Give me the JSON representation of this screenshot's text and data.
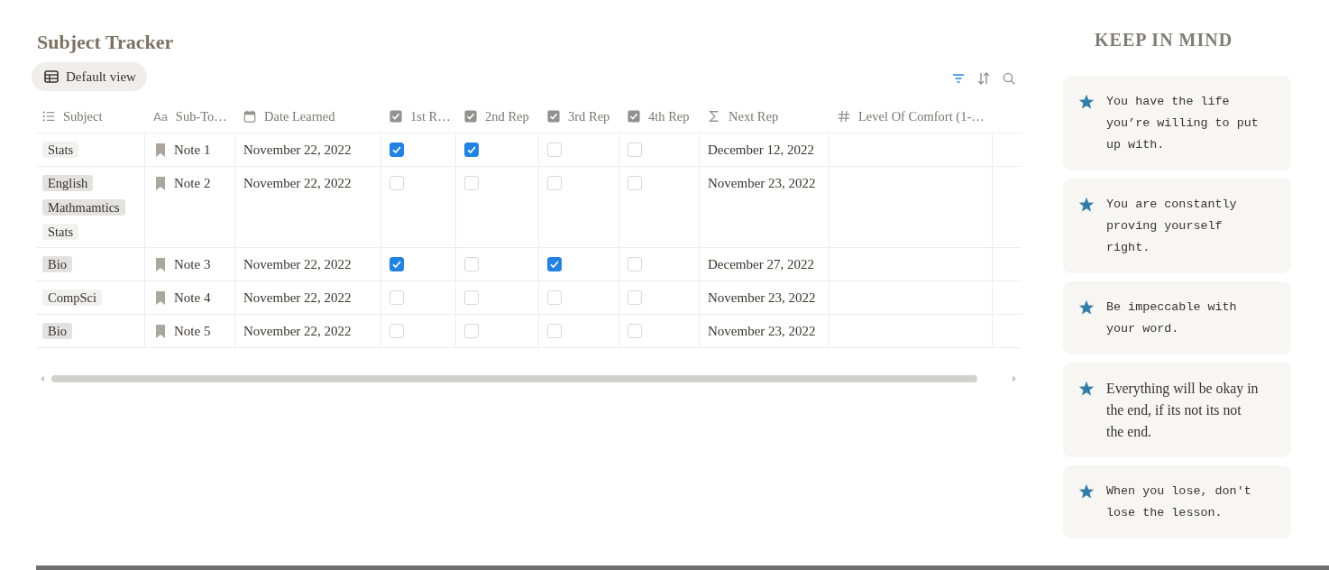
{
  "page": {
    "title": "Subject Tracker"
  },
  "toolbar": {
    "view_tab": {
      "label": "Default view",
      "selected": true
    },
    "actions": [
      {
        "kind": "filter",
        "active": true
      },
      {
        "kind": "sort",
        "active": false
      },
      {
        "kind": "search",
        "active": false
      }
    ]
  },
  "table": {
    "columns": [
      {
        "kind": "multi_select",
        "label": "Subject"
      },
      {
        "kind": "title",
        "label": "Sub-To…",
        "glyph": "Aa"
      },
      {
        "kind": "date",
        "label": "Date Learned"
      },
      {
        "kind": "checkbox",
        "label": "1st R…"
      },
      {
        "kind": "checkbox",
        "label": "2nd Rep"
      },
      {
        "kind": "checkbox",
        "label": "3rd Rep"
      },
      {
        "kind": "checkbox",
        "label": "4th Rep"
      },
      {
        "kind": "formula",
        "label": "Next Rep"
      },
      {
        "kind": "number",
        "label": "Level Of Comfort (1-…"
      }
    ],
    "rows": [
      {
        "subject": [
          {
            "label": "Stats",
            "color": "#f1f1ef"
          }
        ],
        "sub_topic": "Note 1",
        "date_learned": "November 22, 2022",
        "reps": [
          {
            "checked": true
          },
          {
            "checked": true
          },
          {
            "checked": false
          },
          {
            "checked": false
          }
        ],
        "next_rep": "December 12, 2022"
      },
      {
        "subject": [
          {
            "label": "English",
            "color": "#e3e2e0"
          },
          {
            "label": "Mathmamtics",
            "color": "#e3e2e0"
          },
          {
            "label": "Stats",
            "color": "#f1f1ef"
          }
        ],
        "sub_topic": "Note 2",
        "date_learned": "November 22, 2022",
        "reps": [
          {
            "checked": false
          },
          {
            "checked": false
          },
          {
            "checked": false
          },
          {
            "checked": false
          }
        ],
        "next_rep": "November 23, 2022"
      },
      {
        "subject": [
          {
            "label": "Bio",
            "color": "#e3e2e0"
          }
        ],
        "sub_topic": "Note 3",
        "date_learned": "November 22, 2022",
        "reps": [
          {
            "checked": true
          },
          {
            "checked": false
          },
          {
            "checked": true
          },
          {
            "checked": false
          }
        ],
        "next_rep": "December 27, 2022"
      },
      {
        "subject": [
          {
            "label": "CompSci",
            "color": "#f1f1ef"
          }
        ],
        "sub_topic": "Note 4",
        "date_learned": "November 22, 2022",
        "reps": [
          {
            "checked": false
          },
          {
            "checked": false
          },
          {
            "checked": false
          },
          {
            "checked": false
          }
        ],
        "next_rep": "November 23, 2022"
      },
      {
        "subject": [
          {
            "label": "Bio",
            "color": "#e3e2e0"
          }
        ],
        "sub_topic": "Note 5",
        "date_learned": "November 22, 2022",
        "reps": [
          {
            "checked": false
          },
          {
            "checked": false
          },
          {
            "checked": false
          },
          {
            "checked": false
          }
        ],
        "next_rep": "November 23, 2022"
      }
    ]
  },
  "sidebar": {
    "title": "KEEP IN MIND",
    "callouts": [
      {
        "kind": "typewriter",
        "text": "You have the life you’re willing to put up with."
      },
      {
        "kind": "typewriter",
        "text": "You are constantly proving yourself right."
      },
      {
        "kind": "typewriter",
        "text": "Be impeccable with your word."
      },
      {
        "kind": "plain",
        "text": "Everything will be okay in the end, if its not its not the end."
      },
      {
        "kind": "typewriter",
        "text": "When you lose, don't lose the lesson."
      }
    ]
  }
}
